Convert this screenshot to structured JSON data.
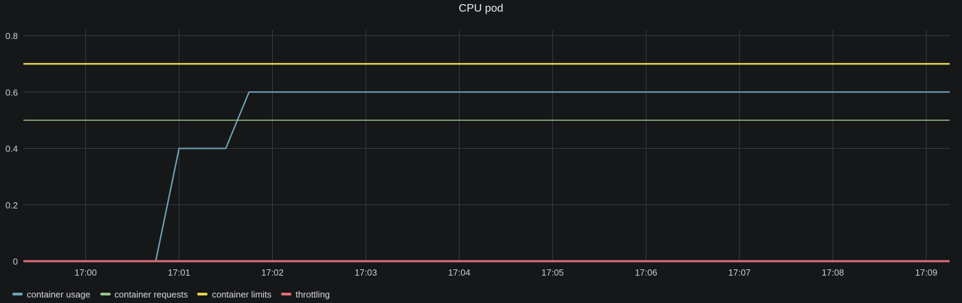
{
  "panel": {
    "title": "CPU pod"
  },
  "colors": {
    "background": "#161719",
    "grid": "#3b3d41",
    "container_usage": "#6fa5ba",
    "container_requests": "#9ac48a",
    "container_limits": "#e0d44d",
    "throttling": "#e06d78"
  },
  "chart_data": {
    "type": "line",
    "title": "CPU pod",
    "xlabel": "",
    "ylabel": "",
    "x_ticks": [
      "17:00",
      "17:01",
      "17:02",
      "17:03",
      "17:04",
      "17:05",
      "17:06",
      "17:07",
      "17:08",
      "17:09"
    ],
    "y_ticks": [
      "0",
      "0.2",
      "0.4",
      "0.6",
      "0.8"
    ],
    "xlim": [
      "16:59:20",
      "17:09:15"
    ],
    "ylim": [
      0,
      0.8
    ],
    "grid": true,
    "legend_position": "bottom-left",
    "series": [
      {
        "name": "container usage",
        "color": "#6fa5ba",
        "points": [
          [
            "16:59:20",
            0
          ],
          [
            "17:00:45",
            0
          ],
          [
            "17:01:00",
            0.4
          ],
          [
            "17:01:30",
            0.4
          ],
          [
            "17:01:45",
            0.6
          ],
          [
            "17:09:15",
            0.6
          ]
        ]
      },
      {
        "name": "container requests",
        "color": "#9ac48a",
        "points": [
          [
            "16:59:20",
            0.5
          ],
          [
            "17:09:15",
            0.5
          ]
        ]
      },
      {
        "name": "container limits",
        "color": "#e0d44d",
        "points": [
          [
            "16:59:20",
            0.7
          ],
          [
            "17:09:15",
            0.7
          ]
        ]
      },
      {
        "name": "throttling",
        "color": "#e06d78",
        "points": [
          [
            "16:59:20",
            0
          ],
          [
            "17:09:15",
            0
          ]
        ]
      }
    ]
  }
}
